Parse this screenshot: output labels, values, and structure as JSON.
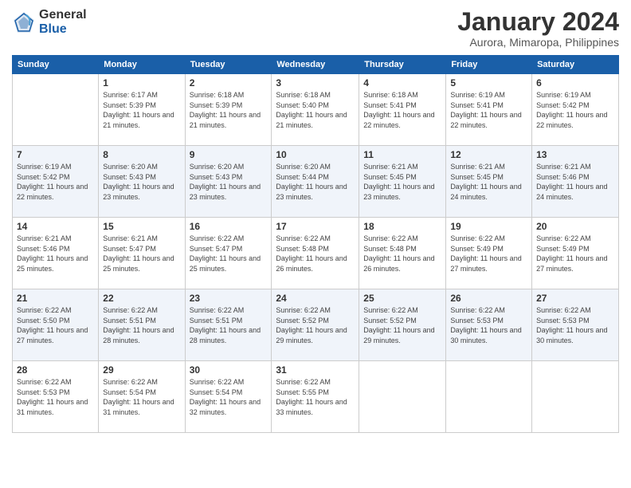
{
  "logo": {
    "general": "General",
    "blue": "Blue"
  },
  "title": "January 2024",
  "location": "Aurora, Mimaropa, Philippines",
  "weekdays": [
    "Sunday",
    "Monday",
    "Tuesday",
    "Wednesday",
    "Thursday",
    "Friday",
    "Saturday"
  ],
  "weeks": [
    [
      {
        "day": "",
        "sunrise": "",
        "sunset": "",
        "daylight": ""
      },
      {
        "day": "1",
        "sunrise": "Sunrise: 6:17 AM",
        "sunset": "Sunset: 5:39 PM",
        "daylight": "Daylight: 11 hours and 21 minutes."
      },
      {
        "day": "2",
        "sunrise": "Sunrise: 6:18 AM",
        "sunset": "Sunset: 5:39 PM",
        "daylight": "Daylight: 11 hours and 21 minutes."
      },
      {
        "day": "3",
        "sunrise": "Sunrise: 6:18 AM",
        "sunset": "Sunset: 5:40 PM",
        "daylight": "Daylight: 11 hours and 21 minutes."
      },
      {
        "day": "4",
        "sunrise": "Sunrise: 6:18 AM",
        "sunset": "Sunset: 5:41 PM",
        "daylight": "Daylight: 11 hours and 22 minutes."
      },
      {
        "day": "5",
        "sunrise": "Sunrise: 6:19 AM",
        "sunset": "Sunset: 5:41 PM",
        "daylight": "Daylight: 11 hours and 22 minutes."
      },
      {
        "day": "6",
        "sunrise": "Sunrise: 6:19 AM",
        "sunset": "Sunset: 5:42 PM",
        "daylight": "Daylight: 11 hours and 22 minutes."
      }
    ],
    [
      {
        "day": "7",
        "sunrise": "Sunrise: 6:19 AM",
        "sunset": "Sunset: 5:42 PM",
        "daylight": "Daylight: 11 hours and 22 minutes."
      },
      {
        "day": "8",
        "sunrise": "Sunrise: 6:20 AM",
        "sunset": "Sunset: 5:43 PM",
        "daylight": "Daylight: 11 hours and 23 minutes."
      },
      {
        "day": "9",
        "sunrise": "Sunrise: 6:20 AM",
        "sunset": "Sunset: 5:43 PM",
        "daylight": "Daylight: 11 hours and 23 minutes."
      },
      {
        "day": "10",
        "sunrise": "Sunrise: 6:20 AM",
        "sunset": "Sunset: 5:44 PM",
        "daylight": "Daylight: 11 hours and 23 minutes."
      },
      {
        "day": "11",
        "sunrise": "Sunrise: 6:21 AM",
        "sunset": "Sunset: 5:45 PM",
        "daylight": "Daylight: 11 hours and 23 minutes."
      },
      {
        "day": "12",
        "sunrise": "Sunrise: 6:21 AM",
        "sunset": "Sunset: 5:45 PM",
        "daylight": "Daylight: 11 hours and 24 minutes."
      },
      {
        "day": "13",
        "sunrise": "Sunrise: 6:21 AM",
        "sunset": "Sunset: 5:46 PM",
        "daylight": "Daylight: 11 hours and 24 minutes."
      }
    ],
    [
      {
        "day": "14",
        "sunrise": "Sunrise: 6:21 AM",
        "sunset": "Sunset: 5:46 PM",
        "daylight": "Daylight: 11 hours and 25 minutes."
      },
      {
        "day": "15",
        "sunrise": "Sunrise: 6:21 AM",
        "sunset": "Sunset: 5:47 PM",
        "daylight": "Daylight: 11 hours and 25 minutes."
      },
      {
        "day": "16",
        "sunrise": "Sunrise: 6:22 AM",
        "sunset": "Sunset: 5:47 PM",
        "daylight": "Daylight: 11 hours and 25 minutes."
      },
      {
        "day": "17",
        "sunrise": "Sunrise: 6:22 AM",
        "sunset": "Sunset: 5:48 PM",
        "daylight": "Daylight: 11 hours and 26 minutes."
      },
      {
        "day": "18",
        "sunrise": "Sunrise: 6:22 AM",
        "sunset": "Sunset: 5:48 PM",
        "daylight": "Daylight: 11 hours and 26 minutes."
      },
      {
        "day": "19",
        "sunrise": "Sunrise: 6:22 AM",
        "sunset": "Sunset: 5:49 PM",
        "daylight": "Daylight: 11 hours and 27 minutes."
      },
      {
        "day": "20",
        "sunrise": "Sunrise: 6:22 AM",
        "sunset": "Sunset: 5:49 PM",
        "daylight": "Daylight: 11 hours and 27 minutes."
      }
    ],
    [
      {
        "day": "21",
        "sunrise": "Sunrise: 6:22 AM",
        "sunset": "Sunset: 5:50 PM",
        "daylight": "Daylight: 11 hours and 27 minutes."
      },
      {
        "day": "22",
        "sunrise": "Sunrise: 6:22 AM",
        "sunset": "Sunset: 5:51 PM",
        "daylight": "Daylight: 11 hours and 28 minutes."
      },
      {
        "day": "23",
        "sunrise": "Sunrise: 6:22 AM",
        "sunset": "Sunset: 5:51 PM",
        "daylight": "Daylight: 11 hours and 28 minutes."
      },
      {
        "day": "24",
        "sunrise": "Sunrise: 6:22 AM",
        "sunset": "Sunset: 5:52 PM",
        "daylight": "Daylight: 11 hours and 29 minutes."
      },
      {
        "day": "25",
        "sunrise": "Sunrise: 6:22 AM",
        "sunset": "Sunset: 5:52 PM",
        "daylight": "Daylight: 11 hours and 29 minutes."
      },
      {
        "day": "26",
        "sunrise": "Sunrise: 6:22 AM",
        "sunset": "Sunset: 5:53 PM",
        "daylight": "Daylight: 11 hours and 30 minutes."
      },
      {
        "day": "27",
        "sunrise": "Sunrise: 6:22 AM",
        "sunset": "Sunset: 5:53 PM",
        "daylight": "Daylight: 11 hours and 30 minutes."
      }
    ],
    [
      {
        "day": "28",
        "sunrise": "Sunrise: 6:22 AM",
        "sunset": "Sunset: 5:53 PM",
        "daylight": "Daylight: 11 hours and 31 minutes."
      },
      {
        "day": "29",
        "sunrise": "Sunrise: 6:22 AM",
        "sunset": "Sunset: 5:54 PM",
        "daylight": "Daylight: 11 hours and 31 minutes."
      },
      {
        "day": "30",
        "sunrise": "Sunrise: 6:22 AM",
        "sunset": "Sunset: 5:54 PM",
        "daylight": "Daylight: 11 hours and 32 minutes."
      },
      {
        "day": "31",
        "sunrise": "Sunrise: 6:22 AM",
        "sunset": "Sunset: 5:55 PM",
        "daylight": "Daylight: 11 hours and 33 minutes."
      },
      {
        "day": "",
        "sunrise": "",
        "sunset": "",
        "daylight": ""
      },
      {
        "day": "",
        "sunrise": "",
        "sunset": "",
        "daylight": ""
      },
      {
        "day": "",
        "sunrise": "",
        "sunset": "",
        "daylight": ""
      }
    ]
  ]
}
